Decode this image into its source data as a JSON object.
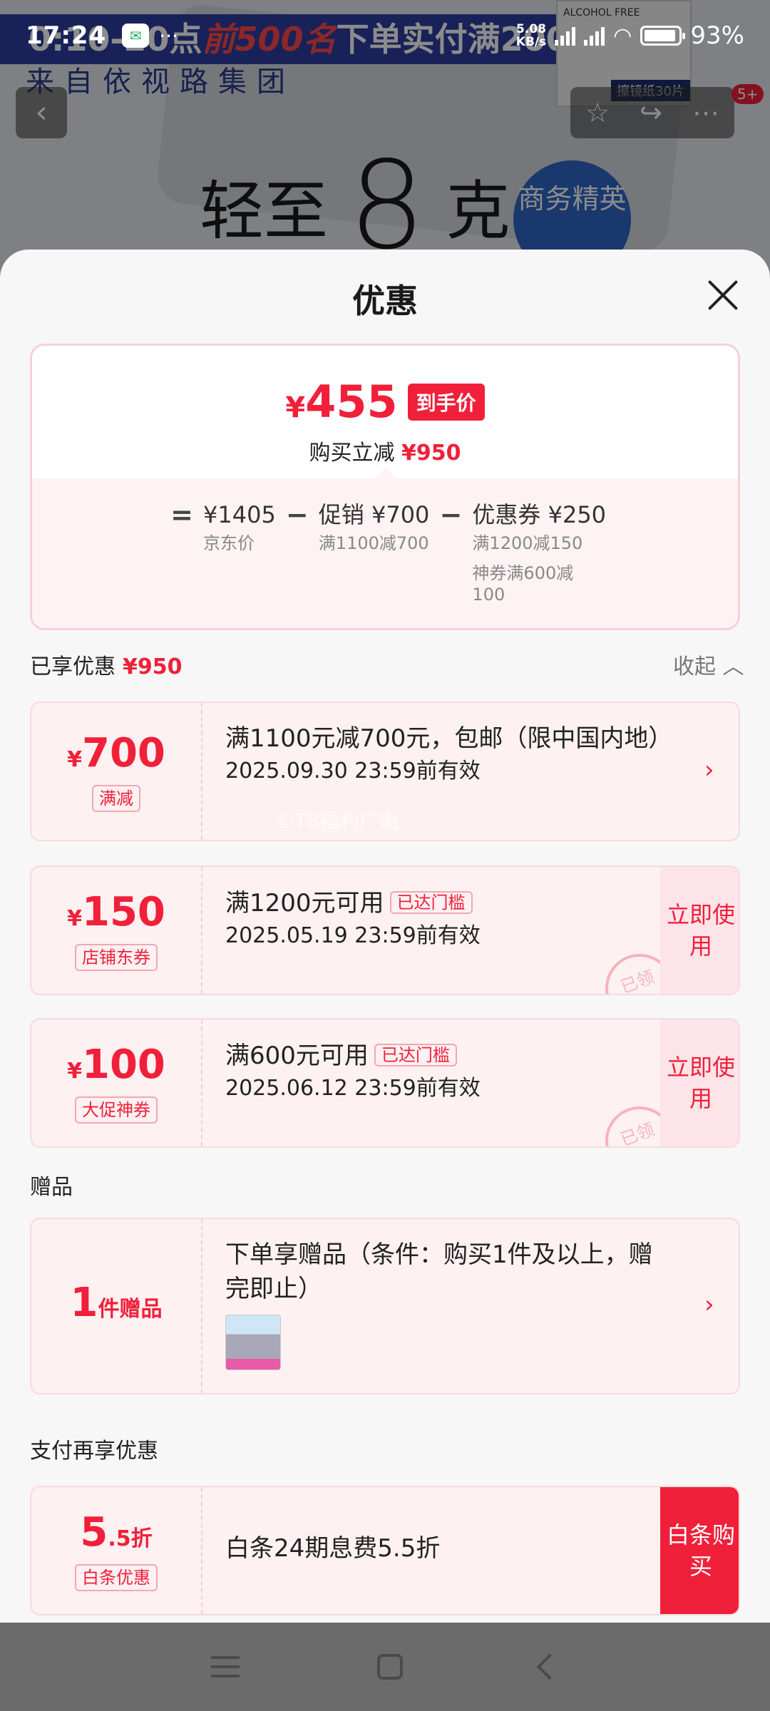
{
  "status_bar": {
    "time": "17:24",
    "app_icon": "wechat-icon",
    "net_speed": "5.08",
    "net_unit": "KB/s",
    "battery": "93%"
  },
  "background": {
    "banner_prefix": "0:10-20点",
    "banner_highlight": "前500名",
    "banner_suffix": "下单实付满2000元",
    "group": "来自依视路集团",
    "glasses_text": "ALCOHOL FREE",
    "glasses_tag": "擦镜纸30片",
    "slogan_a": "轻至",
    "slogan_num": "8",
    "slogan_b": "克",
    "badge": "商务精英",
    "cart_count": "5+"
  },
  "sheet": {
    "title": "优惠",
    "summary": {
      "final_price": "455",
      "currency": "¥",
      "final_tag": "到手价",
      "save_label": "购买立减",
      "save_amount": "¥950",
      "formula": {
        "eq": "=",
        "minus": "−",
        "jd_price": "¥1405",
        "jd_price_label": "京东价",
        "promo": "促销 ¥700",
        "promo_detail": "满1100减700",
        "coupon": "优惠券 ¥250",
        "coupon_detail_1": "满1200减150",
        "coupon_detail_2": "神券满600减100"
      }
    },
    "enjoyed": {
      "label": "已享优惠",
      "amount": "¥950",
      "collapse": "收起"
    },
    "coupons": [
      {
        "amount": "700",
        "tag": "满减",
        "title": "满1100元减700元，包邮（限中国内地）",
        "expiry": "2025.09.30 23:59前有效"
      },
      {
        "amount": "150",
        "tag": "店铺东券",
        "title": "满1200元可用",
        "status": "已达门槛",
        "expiry": "2025.05.19 23:59前有效",
        "action": "立即使用",
        "stamp": "已领"
      },
      {
        "amount": "100",
        "tag": "大促神券",
        "title": "满600元可用",
        "status": "已达门槛",
        "expiry": "2025.06.12 23:59前有效",
        "action": "立即使用",
        "stamp": "已领"
      }
    ],
    "gift": {
      "section": "赠品",
      "count": "1",
      "count_unit": "件赠品",
      "title": "下单享赠品（条件：购买1件及以上，赠完即止）"
    },
    "pay": {
      "section": "支付再享优惠",
      "discount": "5",
      "discount_unit": ".5折",
      "tag": "白条优惠",
      "title": "白条24期息费5.5折",
      "action": "白条购买"
    },
    "watermark": "©T8福利广逝"
  }
}
